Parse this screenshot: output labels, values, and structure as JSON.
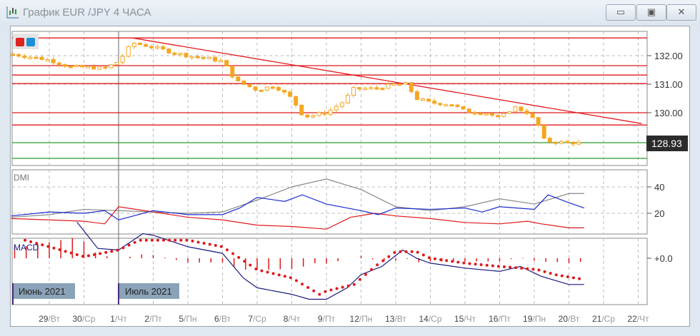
{
  "window": {
    "title": "График EUR /JPY  4 ЧАСА",
    "buttons": {
      "minimize": "▭",
      "maximize": "▣",
      "close": "✕"
    }
  },
  "toolbar": {
    "red_button": "red",
    "blue_button": "blue"
  },
  "price_panel": {
    "ticks": [
      "132.00",
      "131.00",
      "130.00"
    ],
    "tick_values": [
      132,
      131,
      130
    ],
    "current_price": "128.93",
    "current_value": 128.93,
    "red_levels": [
      132.62,
      131.65,
      131.32,
      131.02,
      130.0,
      129.57
    ],
    "green_levels": [
      128.95,
      128.4
    ],
    "trendline": [
      [
        3.4,
        132.62
      ],
      [
        18.1,
        129.62
      ]
    ],
    "closes": [
      [
        -0.1,
        132.05
      ],
      [
        0.5,
        131.95
      ],
      [
        1,
        131.85
      ],
      [
        1.6,
        131.6
      ],
      [
        2,
        131.6
      ],
      [
        2.6,
        131.55
      ],
      [
        3,
        131.8
      ],
      [
        3.4,
        132.45
      ],
      [
        4,
        132.3
      ],
      [
        4.6,
        132.1
      ],
      [
        5,
        132.0
      ],
      [
        5.6,
        131.9
      ],
      [
        6,
        131.8
      ],
      [
        6.4,
        131.1
      ],
      [
        7,
        130.8
      ],
      [
        7.5,
        130.95
      ],
      [
        8,
        130.5
      ],
      [
        8.35,
        129.85
      ],
      [
        9,
        130.0
      ],
      [
        9.5,
        130.4
      ],
      [
        9.8,
        130.85
      ],
      [
        10.4,
        130.85
      ],
      [
        11,
        131.0
      ],
      [
        11.3,
        131.0
      ],
      [
        11.6,
        130.5
      ],
      [
        12,
        130.35
      ],
      [
        12.6,
        130.3
      ],
      [
        13,
        130.05
      ],
      [
        13.6,
        130.0
      ],
      [
        14,
        129.8
      ],
      [
        14.4,
        130.2
      ],
      [
        14.8,
        130.0
      ],
      [
        15.1,
        129.6
      ],
      [
        15.3,
        129.0
      ],
      [
        16,
        128.95
      ],
      [
        16.44,
        128.93
      ]
    ]
  },
  "dmi": {
    "label": "DMI",
    "ticks": [
      "40",
      "20"
    ],
    "tick_values": [
      40,
      20
    ],
    "adx": [
      [
        -0.1,
        17
      ],
      [
        1,
        19
      ],
      [
        2,
        23
      ],
      [
        3,
        22
      ],
      [
        4,
        21
      ],
      [
        5,
        20
      ],
      [
        6,
        21
      ],
      [
        7,
        30
      ],
      [
        8,
        40
      ],
      [
        9,
        46
      ],
      [
        10,
        38
      ],
      [
        11,
        25
      ],
      [
        12,
        22
      ],
      [
        13,
        25
      ],
      [
        14,
        31
      ],
      [
        15,
        27
      ],
      [
        16,
        35
      ],
      [
        16.44,
        35
      ]
    ],
    "plus_di": [
      [
        -0.1,
        18
      ],
      [
        1,
        21
      ],
      [
        2,
        20
      ],
      [
        2.6,
        22
      ],
      [
        3,
        15
      ],
      [
        4,
        22
      ],
      [
        5,
        19
      ],
      [
        6,
        19
      ],
      [
        6.5,
        24
      ],
      [
        7,
        32
      ],
      [
        7.8,
        29
      ],
      [
        8.3,
        34
      ],
      [
        9,
        27
      ],
      [
        10,
        22
      ],
      [
        10.5,
        19
      ],
      [
        11,
        24
      ],
      [
        12,
        23
      ],
      [
        13,
        24
      ],
      [
        13.5,
        21
      ],
      [
        14,
        25
      ],
      [
        15,
        23
      ],
      [
        15.4,
        34
      ],
      [
        16,
        28
      ],
      [
        16.44,
        24
      ]
    ],
    "minus_di": [
      [
        -0.1,
        16
      ],
      [
        1,
        15
      ],
      [
        2,
        14
      ],
      [
        2.6,
        12
      ],
      [
        3,
        25
      ],
      [
        4,
        21
      ],
      [
        5,
        17
      ],
      [
        6,
        15
      ],
      [
        7,
        11
      ],
      [
        8,
        10
      ],
      [
        9,
        8
      ],
      [
        9.7,
        17
      ],
      [
        10.4,
        20
      ],
      [
        11,
        18
      ],
      [
        12,
        16
      ],
      [
        13,
        13
      ],
      [
        14,
        12
      ],
      [
        14.8,
        14
      ],
      [
        15.2,
        12
      ],
      [
        16,
        9
      ],
      [
        16.44,
        9
      ]
    ]
  },
  "macd": {
    "label": "MACD",
    "tick": "+0.0",
    "tick_value": 0,
    "line": [
      [
        1.8,
        0.22
      ],
      [
        2.4,
        0.06
      ],
      [
        3,
        0.05
      ],
      [
        3.7,
        0.15
      ],
      [
        4,
        0.14
      ],
      [
        5,
        0.07
      ],
      [
        6,
        0.03
      ],
      [
        6.6,
        -0.12
      ],
      [
        7,
        -0.18
      ],
      [
        8,
        -0.22
      ],
      [
        8.5,
        -0.25
      ],
      [
        9,
        -0.25
      ],
      [
        9.6,
        -0.18
      ],
      [
        10,
        -0.1
      ],
      [
        10.6,
        -0.05
      ],
      [
        11.2,
        0.05
      ],
      [
        11.6,
        0.0
      ],
      [
        12,
        -0.03
      ],
      [
        13,
        -0.06
      ],
      [
        14,
        -0.08
      ],
      [
        14.6,
        -0.05
      ],
      [
        15.2,
        -0.11
      ],
      [
        16,
        -0.16
      ],
      [
        16.44,
        -0.16
      ]
    ],
    "signal": [
      [
        0.3,
        0.11
      ],
      [
        1,
        0.07
      ],
      [
        2,
        0.01
      ],
      [
        3,
        0.05
      ],
      [
        3.6,
        0.11
      ],
      [
        4,
        0.11
      ],
      [
        5,
        0.11
      ],
      [
        6,
        0.07
      ],
      [
        7,
        -0.07
      ],
      [
        8,
        -0.12
      ],
      [
        8.8,
        -0.22
      ],
      [
        9,
        -0.2
      ],
      [
        9.8,
        -0.16
      ],
      [
        10.4,
        -0.05
      ],
      [
        11,
        0.04
      ],
      [
        11.6,
        0.04
      ],
      [
        12,
        0.0
      ],
      [
        13,
        -0.03
      ],
      [
        14,
        -0.05
      ],
      [
        14.6,
        -0.06
      ],
      [
        15.1,
        -0.07
      ],
      [
        15.6,
        -0.1
      ],
      [
        16.44,
        -0.13
      ]
    ]
  },
  "month_labels": [
    "Июнь 2021",
    "Июль 2021"
  ],
  "days": [
    {
      "d": "29",
      "w": "/Вт"
    },
    {
      "d": "30",
      "w": "/Ср"
    },
    {
      "d": "1",
      "w": "/Чт"
    },
    {
      "d": "2",
      "w": "/Пт"
    },
    {
      "d": "5",
      "w": "/Пн"
    },
    {
      "d": "6",
      "w": "/Вт"
    },
    {
      "d": "7",
      "w": "/Ср"
    },
    {
      "d": "8",
      "w": "/Чт"
    },
    {
      "d": "9",
      "w": "/Пт"
    },
    {
      "d": "12",
      "w": "/Пн"
    },
    {
      "d": "13",
      "w": "/Вт"
    },
    {
      "d": "14",
      "w": "/Ср"
    },
    {
      "d": "15",
      "w": "/Чт"
    },
    {
      "d": "16",
      "w": "/Пт"
    },
    {
      "d": "19",
      "w": "/Пн"
    },
    {
      "d": "20",
      "w": "/Вт"
    },
    {
      "d": "21",
      "w": "/Ср"
    },
    {
      "d": "22",
      "w": "/Чт"
    }
  ],
  "colors": {
    "candle": "#f5a623",
    "red": "#e0191c",
    "green": "#2e9b2e",
    "blue": "#1a2bd0",
    "adx": "#888888",
    "macd": "#1a1a80"
  }
}
